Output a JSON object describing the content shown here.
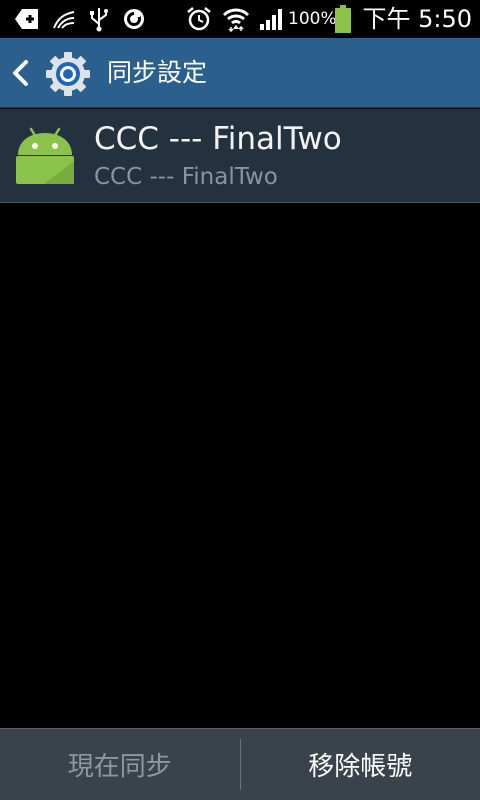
{
  "status_bar": {
    "icons": [
      "add-icon",
      "bird-icon",
      "usb-icon",
      "sync-circle-icon",
      "alarm-icon",
      "wifi-icon",
      "signal-icon",
      "battery-icon"
    ],
    "battery_percent": "100%",
    "time": "下午 5:50",
    "battery_color": "#8bc34a"
  },
  "header": {
    "title": "同步設定",
    "back_icon": "chevron-left-icon",
    "app_icon": "settings-gear-icon",
    "bg_color": "#2b5f8e"
  },
  "account": {
    "name": "CCC --- FinalTwo",
    "subtitle": "CCC --- FinalTwo",
    "icon": "android-icon",
    "icon_color": "#8bc34a"
  },
  "bottom_bar": {
    "sync_now_label": "現在同步",
    "remove_account_label": "移除帳號"
  }
}
